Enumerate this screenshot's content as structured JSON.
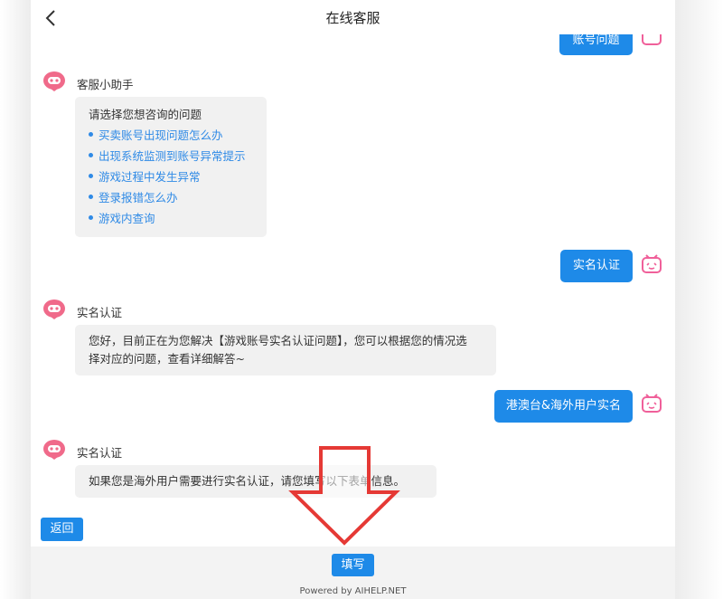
{
  "header": {
    "title": "在线客服"
  },
  "messages": {
    "user_top": "账号问题",
    "bot1": {
      "name": "客服小助手",
      "prompt": "请选择您想咨询的问题",
      "options": [
        "买卖账号出现问题怎么办",
        "出现系统监测到账号异常提示",
        "游戏过程中发生异常",
        "登录报错怎么办",
        "游戏内查询"
      ]
    },
    "user1": "实名认证",
    "bot2": {
      "name": "实名认证",
      "line1": "您好，目前正在为您解决【游戏账号实名认证问题】，您可以根据您的情况选",
      "line2": "择对应的问题，查看详细解答~"
    },
    "user2": "港澳台&海外用户实名",
    "bot3": {
      "name": "实名认证",
      "text": "如果您是海外用户需要进行实名认证，请您填写以下表单信息。"
    }
  },
  "buttons": {
    "back": "返回",
    "fill": "填写"
  },
  "footer": {
    "powered": "Powered by AIHELP.NET"
  },
  "colors": {
    "accent": "#1e8ae8",
    "link": "#2f8ae6",
    "bot_icon": "#f06a8a",
    "user_icon": "#f0609a",
    "annotation_arrow": "#e53935"
  }
}
